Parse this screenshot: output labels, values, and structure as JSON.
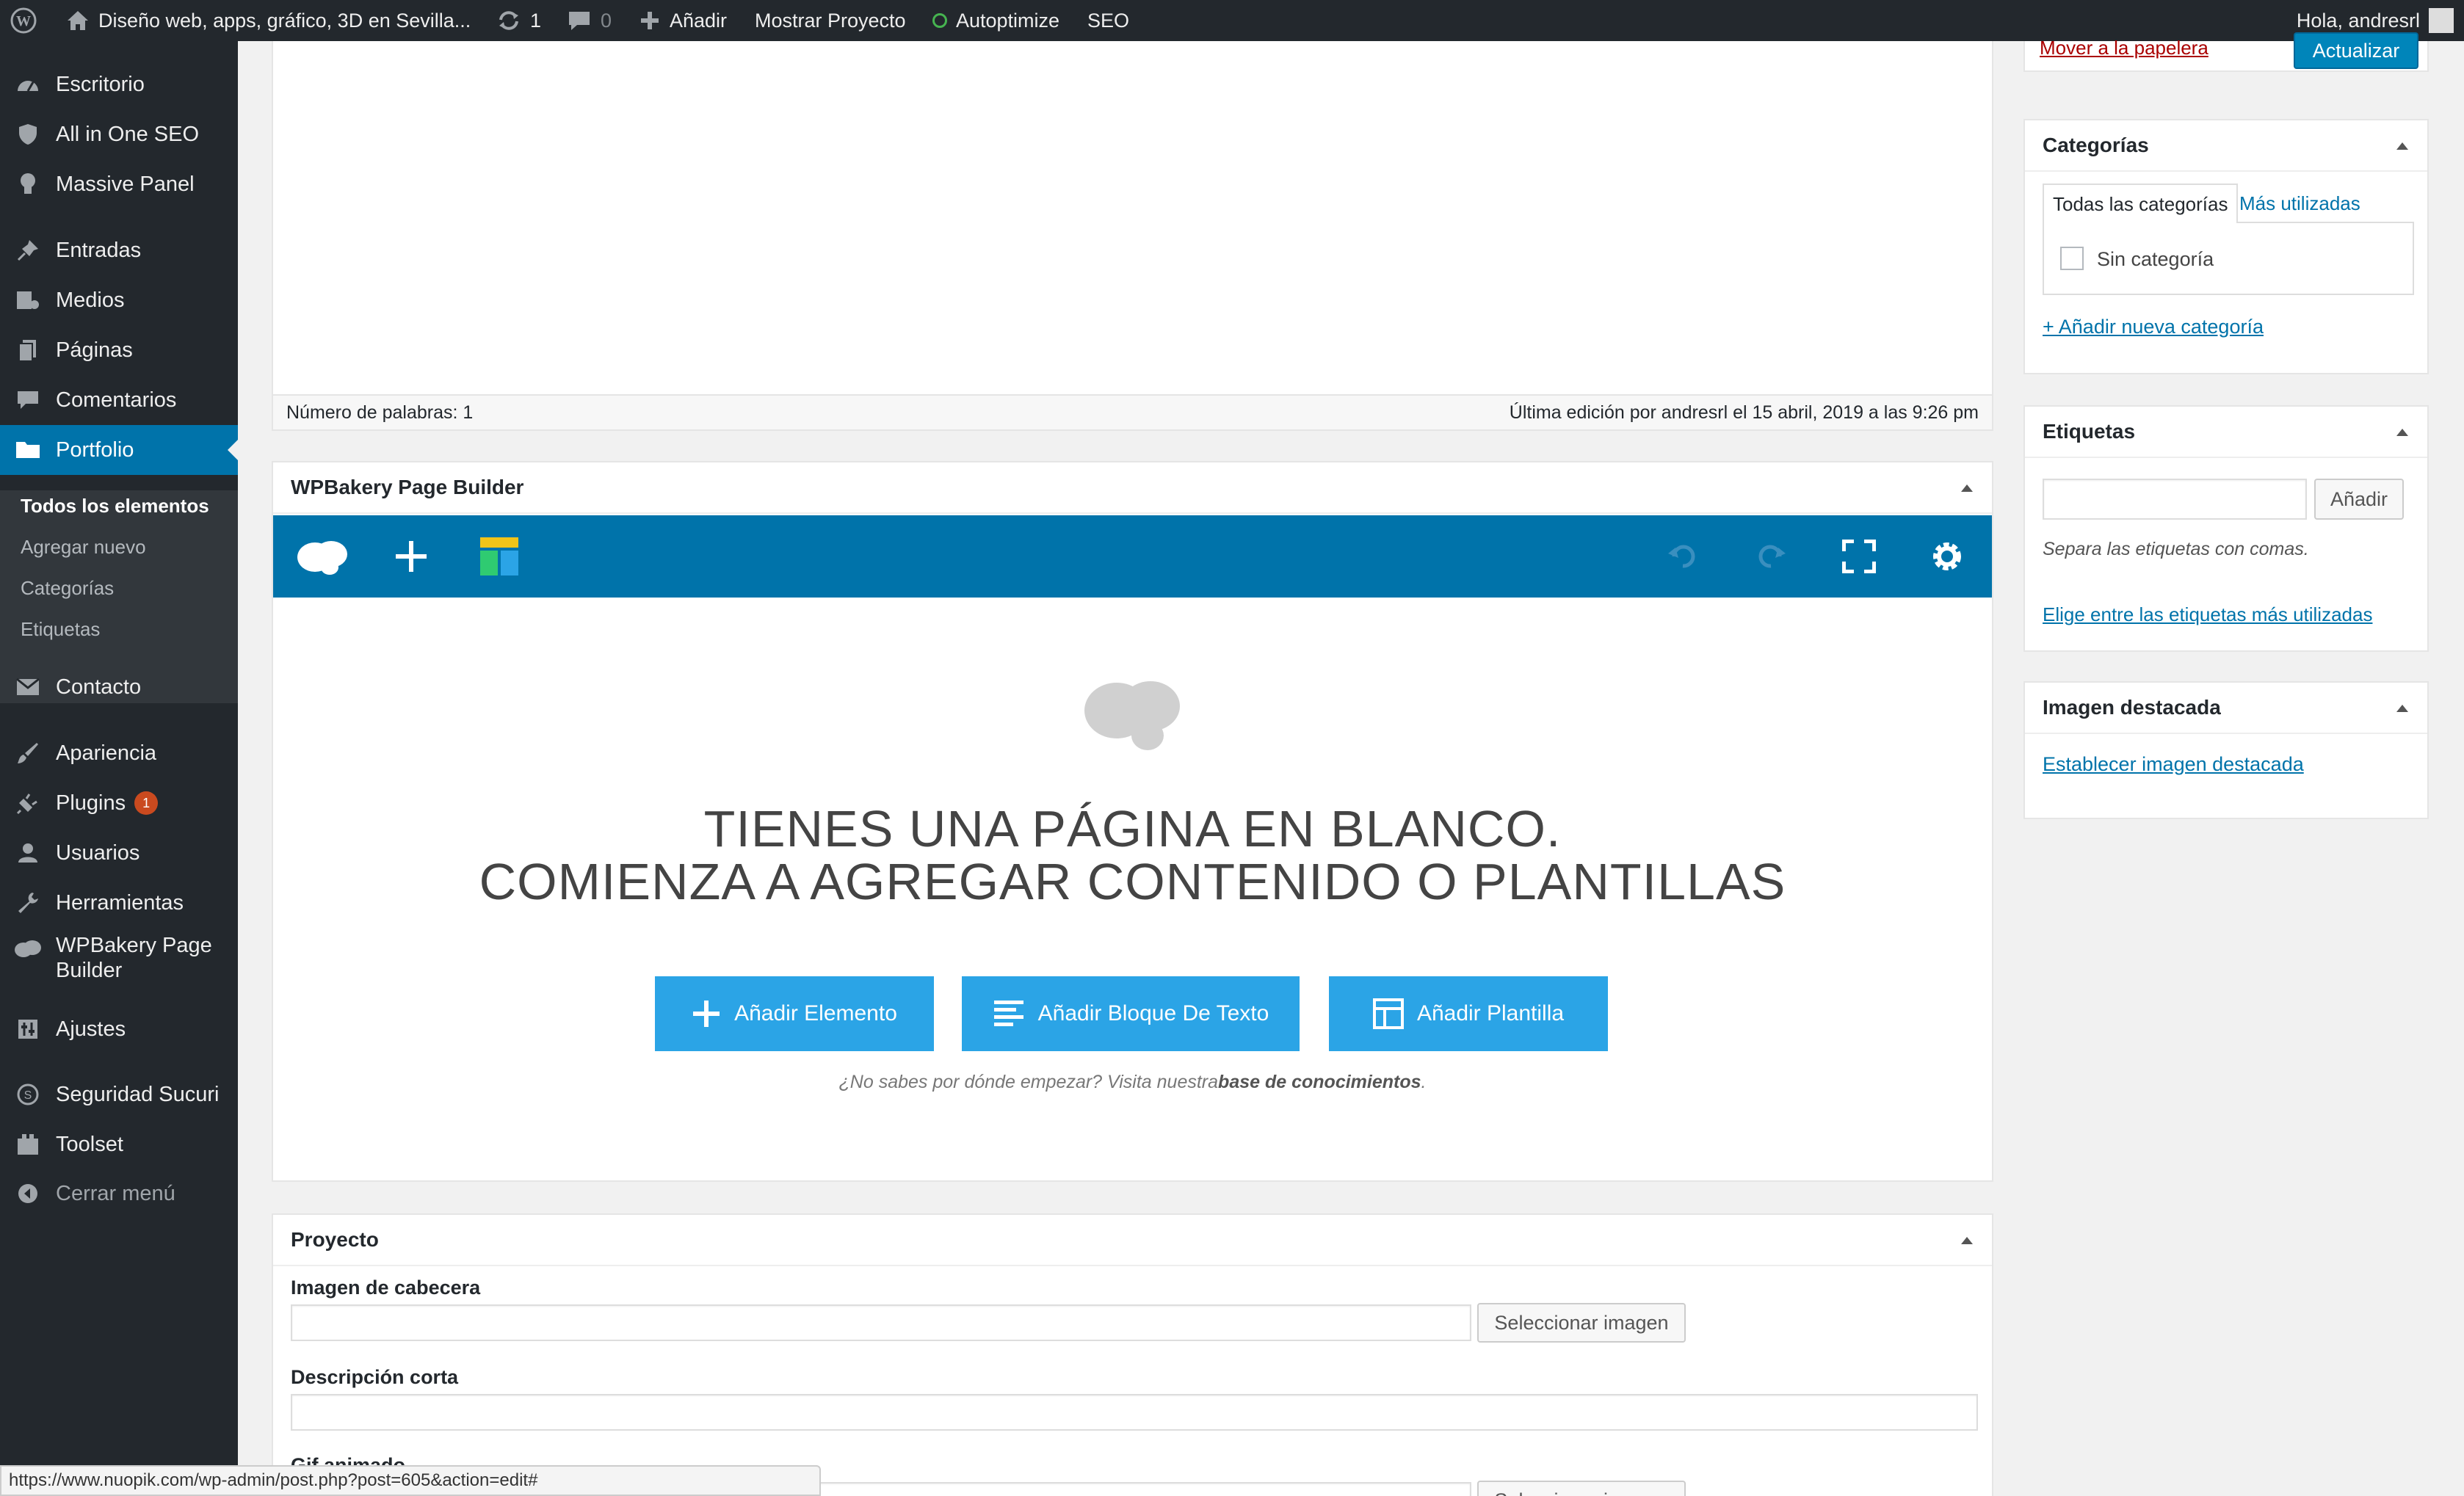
{
  "admin_bar": {
    "site_name": "Diseño web, apps, gráfico, 3D en Sevilla...",
    "updates_count": "1",
    "comments_count": "0",
    "add_label": "Añadir",
    "view_label": "Mostrar Proyecto",
    "autoptimize_label": "Autoptimize",
    "seo_label": "SEO",
    "greeting": "Hola, andresrl"
  },
  "sidebar": {
    "items": [
      {
        "label": "Escritorio",
        "icon": "dashboard-icon"
      },
      {
        "label": "All in One SEO",
        "icon": "shield-icon"
      },
      {
        "label": "Massive Panel",
        "icon": "lightbulb-icon"
      },
      {
        "label": "Entradas",
        "icon": "pin-icon"
      },
      {
        "label": "Medios",
        "icon": "media-icon"
      },
      {
        "label": "Páginas",
        "icon": "pages-icon"
      },
      {
        "label": "Comentarios",
        "icon": "comment-icon"
      },
      {
        "label": "Portfolio",
        "icon": "folder-icon"
      },
      {
        "label": "Contacto",
        "icon": "mail-icon"
      },
      {
        "label": "Apariencia",
        "icon": "brush-icon"
      },
      {
        "label": "Plugins",
        "icon": "plugin-icon",
        "badge": "1"
      },
      {
        "label": "Usuarios",
        "icon": "user-icon"
      },
      {
        "label": "Herramientas",
        "icon": "wrench-icon"
      },
      {
        "label": "WPBakery Page Builder",
        "icon": "cloud-icon"
      },
      {
        "label": "Ajustes",
        "icon": "settings-icon"
      },
      {
        "label": "Seguridad Sucuri",
        "icon": "sucuri-icon"
      },
      {
        "label": "Toolset",
        "icon": "toolset-icon"
      },
      {
        "label": "Cerrar menú",
        "icon": "collapse-icon"
      }
    ],
    "submenu": [
      "Todos los elementos",
      "Agregar nuevo",
      "Categorías",
      "Etiquetas"
    ]
  },
  "editor": {
    "word_count": "Número de palabras: 1",
    "last_edit": "Última edición por andresrl el 15 abril, 2019 a las 9:26 pm"
  },
  "page_builder": {
    "title": "WPBakery Page Builder",
    "blank_line1": "TIENES UNA PÁGINA EN BLANCO.",
    "blank_line2": "COMIENZA A AGREGAR CONTENIDO O PLANTILLAS",
    "btn_add_element": "Añadir Elemento",
    "btn_add_text": "Añadir Bloque De Texto",
    "btn_add_template": "Añadir Plantilla",
    "helper_text": "¿No sabes por dónde empezar? Visita nuestra",
    "helper_link": "base de conocimientos",
    "helper_end": "."
  },
  "project": {
    "title": "Proyecto",
    "header_image_label": "Imagen de cabecera",
    "select_image": "Seleccionar imagen",
    "short_desc_label": "Descripción corta",
    "gif_label": "Gif animado"
  },
  "publish": {
    "trash": "Mover a la papelera",
    "update": "Actualizar"
  },
  "categories": {
    "title": "Categorías",
    "tab_all": "Todas las categorías",
    "tab_popular": "Más utilizadas",
    "item": "Sin categoría",
    "add_new": "+ Añadir nueva categoría"
  },
  "tags": {
    "title": "Etiquetas",
    "add_button": "Añadir",
    "hint": "Separa las etiquetas con comas.",
    "choose": "Elige entre las etiquetas más utilizadas"
  },
  "featured": {
    "title": "Imagen destacada",
    "set": "Establecer imagen destacada"
  },
  "status_url": "https://www.nuopik.com/wp-admin/post.php?post=605&action=edit#",
  "colors": {
    "admin_dark": "#23282d",
    "accent": "#0073aa",
    "vc_button": "#2ba4e6"
  }
}
